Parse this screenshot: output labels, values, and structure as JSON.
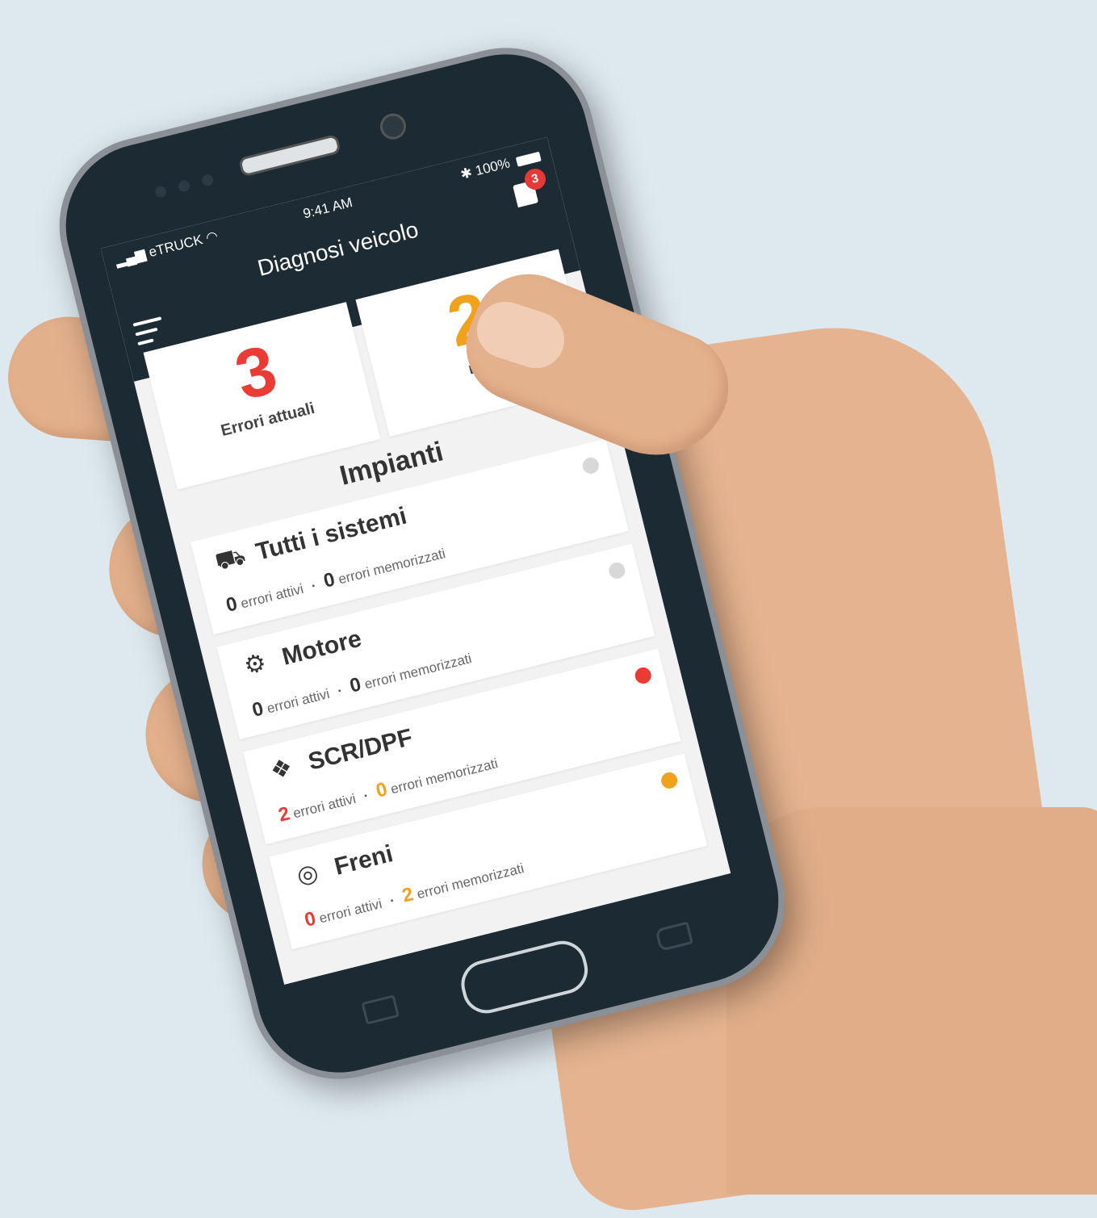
{
  "statusbar": {
    "carrier": "eTRUCK",
    "time": "9:41 AM",
    "battery": "100%"
  },
  "header": {
    "title": "Diagnosi veicolo",
    "notification_count": "3"
  },
  "summary": [
    {
      "value": "3",
      "label": "Errori attuali",
      "color": "#ea3b35"
    },
    {
      "value": "2",
      "label": "me",
      "color": "#f1a21d"
    }
  ],
  "section_title": "Impianti",
  "systems": [
    {
      "name": "Tutti i sistemi",
      "icon": "truck-icon",
      "active": "0",
      "stored": "0",
      "active_label": "errori attivi",
      "stored_label": "errori memorizzati",
      "dot": "#d8d8d8",
      "active_color": "#333333",
      "stored_color": "#333333"
    },
    {
      "name": "Motore",
      "icon": "engine-icon",
      "active": "0",
      "stored": "0",
      "active_label": "errori attivi",
      "stored_label": "errori memorizzati",
      "dot": "#d8d8d8",
      "active_color": "#333333",
      "stored_color": "#333333"
    },
    {
      "name": "SCR/DPF",
      "icon": "filter-icon",
      "active": "2",
      "stored": "0",
      "active_label": "errori attivi",
      "stored_label": "errori memorizzati",
      "dot": "#ea3b35",
      "active_color": "#ea3b35",
      "stored_color": "#f1a21d"
    },
    {
      "name": "Freni",
      "icon": "brake-icon",
      "active": "0",
      "stored": "2",
      "active_label": "errori attivi",
      "stored_label": "errori memorizzati",
      "dot": "#f1a21d",
      "active_color": "#ea3b35",
      "stored_color": "#f1a21d"
    }
  ]
}
